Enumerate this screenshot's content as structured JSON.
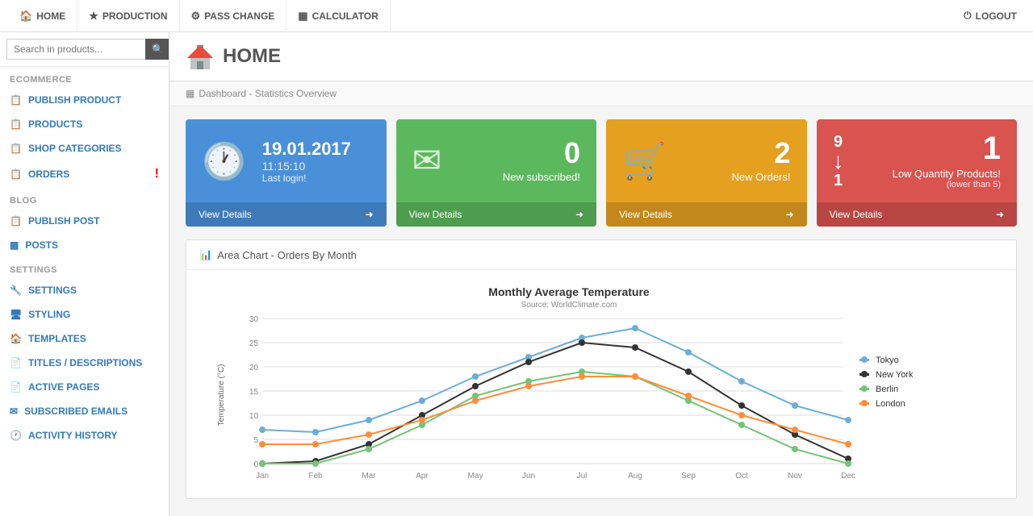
{
  "topnav": {
    "items": [
      {
        "label": "HOME",
        "icon": "🏠",
        "name": "home"
      },
      {
        "label": "PRODUCTION",
        "icon": "★",
        "name": "production"
      },
      {
        "label": "PASS CHANGE",
        "icon": "🔧",
        "name": "pass-change"
      },
      {
        "label": "CALCULATOR",
        "icon": "▦",
        "name": "calculator"
      }
    ],
    "logout_label": "LOGOUT",
    "logout_icon": "⏻"
  },
  "sidebar": {
    "search_placeholder": "Search in products...",
    "sections": [
      {
        "title": "ECOMMERCE",
        "items": [
          {
            "label": "PUBLISH PRODUCT",
            "icon": "📋",
            "name": "publish-product",
            "badge": false
          },
          {
            "label": "PRODUCTS",
            "icon": "📋",
            "name": "products",
            "badge": false
          },
          {
            "label": "SHOP CATEGORIES",
            "icon": "📋",
            "name": "shop-categories",
            "badge": false
          },
          {
            "label": "ORDERS",
            "icon": "📋",
            "name": "orders",
            "badge": true
          }
        ]
      },
      {
        "title": "BLOG",
        "items": [
          {
            "label": "PUBLISH POST",
            "icon": "📋",
            "name": "publish-post",
            "badge": false
          },
          {
            "label": "POSTS",
            "icon": "▦",
            "name": "posts",
            "badge": false
          }
        ]
      },
      {
        "title": "SETTINGS",
        "items": [
          {
            "label": "SETTINGS",
            "icon": "🔧",
            "name": "settings",
            "badge": false
          },
          {
            "label": "STYLING",
            "icon": "🖥",
            "name": "styling",
            "badge": false
          },
          {
            "label": "TEMPLATES",
            "icon": "🏠",
            "name": "templates",
            "badge": false
          },
          {
            "label": "TITLES / DESCRIPTIONS",
            "icon": "📋",
            "name": "titles-descriptions",
            "badge": false
          },
          {
            "label": "ACTIVE PAGES",
            "icon": "📄",
            "name": "active-pages",
            "badge": false
          },
          {
            "label": "SUBSCRIBED EMAILS",
            "icon": "✉",
            "name": "subscribed-emails",
            "badge": false
          },
          {
            "label": "ACTIVITY HISTORY",
            "icon": "🕐",
            "name": "activity-history",
            "badge": false
          }
        ]
      }
    ]
  },
  "page": {
    "title": "HOME",
    "breadcrumb": "Dashboard - Statistics Overview"
  },
  "cards": [
    {
      "type": "blue",
      "date": "19.01.2017",
      "time": "11:15:10",
      "label": "Last login!",
      "footer": "View Details"
    },
    {
      "type": "green",
      "number": "0",
      "label": "New subscribed!",
      "footer": "View Details"
    },
    {
      "type": "orange",
      "number": "2",
      "label": "New Orders!",
      "footer": "View Details"
    },
    {
      "type": "red",
      "number1": "9",
      "number2": "1",
      "label": "Low Quantity Products!",
      "sublabel": "(lower than 5)",
      "footer": "View Details"
    }
  ],
  "chart": {
    "title": "Area Chart - Orders By Month",
    "chart_title": "Monthly Average Temperature",
    "chart_source": "Source: WorldClimate.com",
    "y_label": "Temperature (°C)",
    "y_max": 30,
    "y_ticks": [
      0,
      5,
      10,
      15,
      20,
      25,
      30
    ],
    "x_labels": [
      "Jan",
      "Feb",
      "Mar",
      "Apr",
      "May",
      "Jun",
      "Jul",
      "Aug",
      "Sep",
      "Oct",
      "Nov",
      "Dec"
    ],
    "series": [
      {
        "name": "Tokyo",
        "color": "#6baed6",
        "values": [
          7,
          6.5,
          9,
          13,
          18,
          22,
          26,
          28,
          23,
          17,
          12,
          9
        ]
      },
      {
        "name": "New York",
        "color": "#333333",
        "values": [
          0,
          0.5,
          4,
          10,
          16,
          21,
          25,
          24,
          19,
          12,
          6,
          1
        ]
      },
      {
        "name": "Berlin",
        "color": "#74c476",
        "values": [
          0,
          0,
          3,
          8,
          14,
          17,
          19,
          18,
          13,
          8,
          3,
          0
        ]
      },
      {
        "name": "London",
        "color": "#fd8d3c",
        "values": [
          4,
          4,
          6,
          9,
          13,
          16,
          18,
          18,
          14,
          10,
          7,
          4
        ]
      }
    ],
    "legend": [
      "Tokyo",
      "New York",
      "Berlin",
      "London"
    ],
    "legend_colors": [
      "#6baed6",
      "#333333",
      "#74c476",
      "#fd8d3c"
    ]
  }
}
